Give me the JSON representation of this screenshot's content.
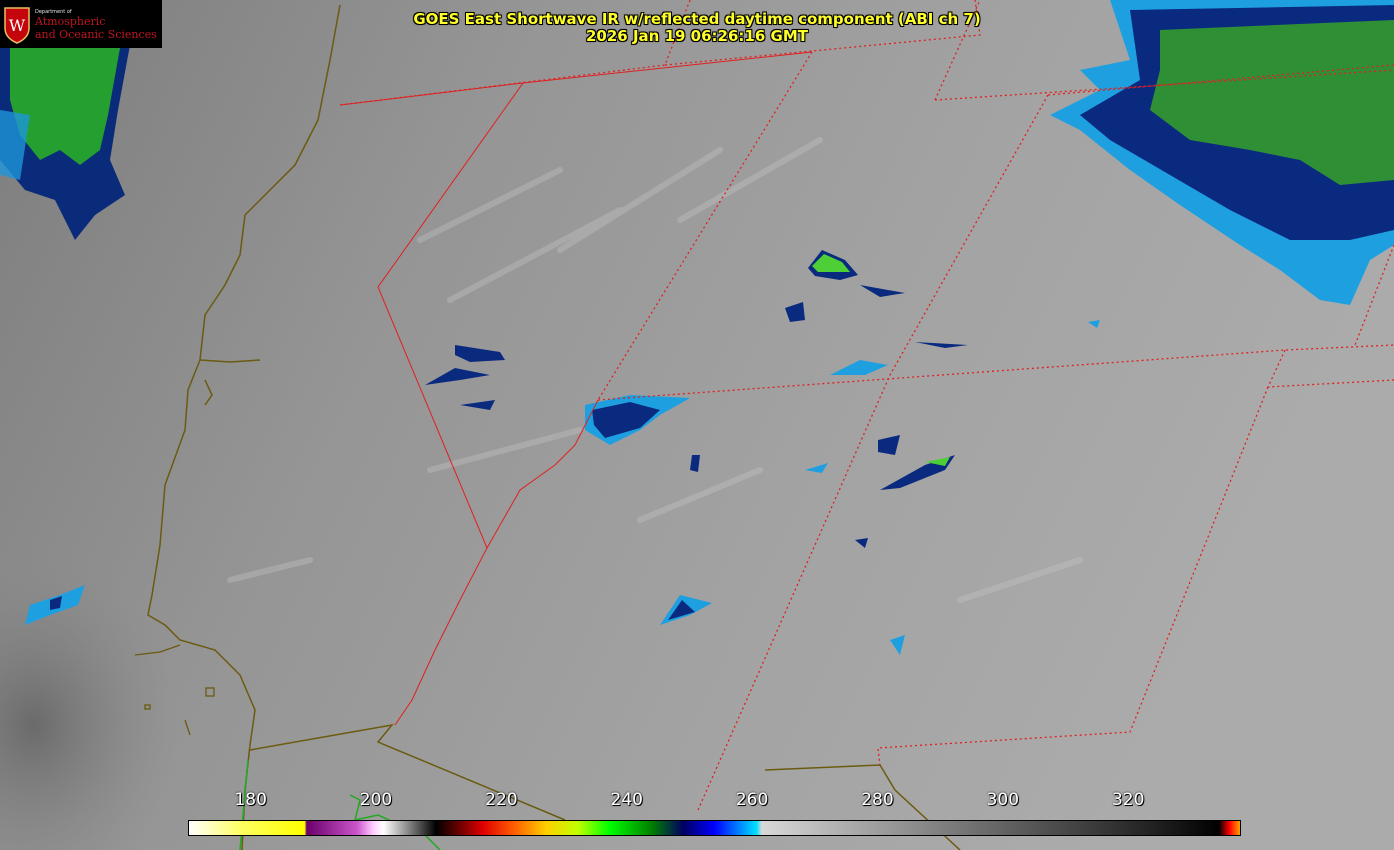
{
  "logo": {
    "line1": "Department of",
    "line2": "Atmospheric",
    "line3": "and Oceanic Sciences",
    "seal_letter": "W"
  },
  "title": {
    "line1": "GOES East Shortwave IR w/reflected daytime component (ABI ch 7)",
    "line2": "2026 Jan 19 06:26:16 GMT"
  },
  "colorbar": {
    "ticks": [
      "180",
      "200",
      "220",
      "240",
      "260",
      "280",
      "300",
      "320"
    ],
    "min": 170,
    "max": 338
  },
  "colors": {
    "title": "#ffff2a",
    "state_borders": "#e02020",
    "coastline": "#6b5a10",
    "land_outline": "#22aa22"
  }
}
